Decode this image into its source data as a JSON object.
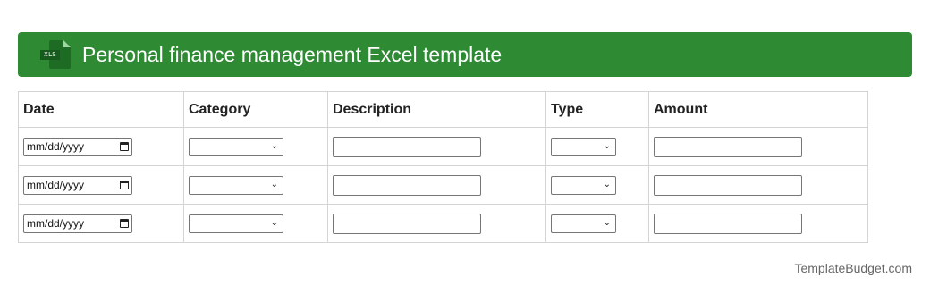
{
  "banner": {
    "icon_label": "XLS",
    "icon": "excel-file-icon",
    "title": "Personal finance management Excel template",
    "color": "#2e8b34"
  },
  "table": {
    "headers": [
      "Date",
      "Category",
      "Description",
      "Type",
      "Amount"
    ],
    "date_placeholder": "mm/dd/yyyy",
    "row_count": 3
  },
  "footer": {
    "brand": "TemplateBudget.com"
  }
}
